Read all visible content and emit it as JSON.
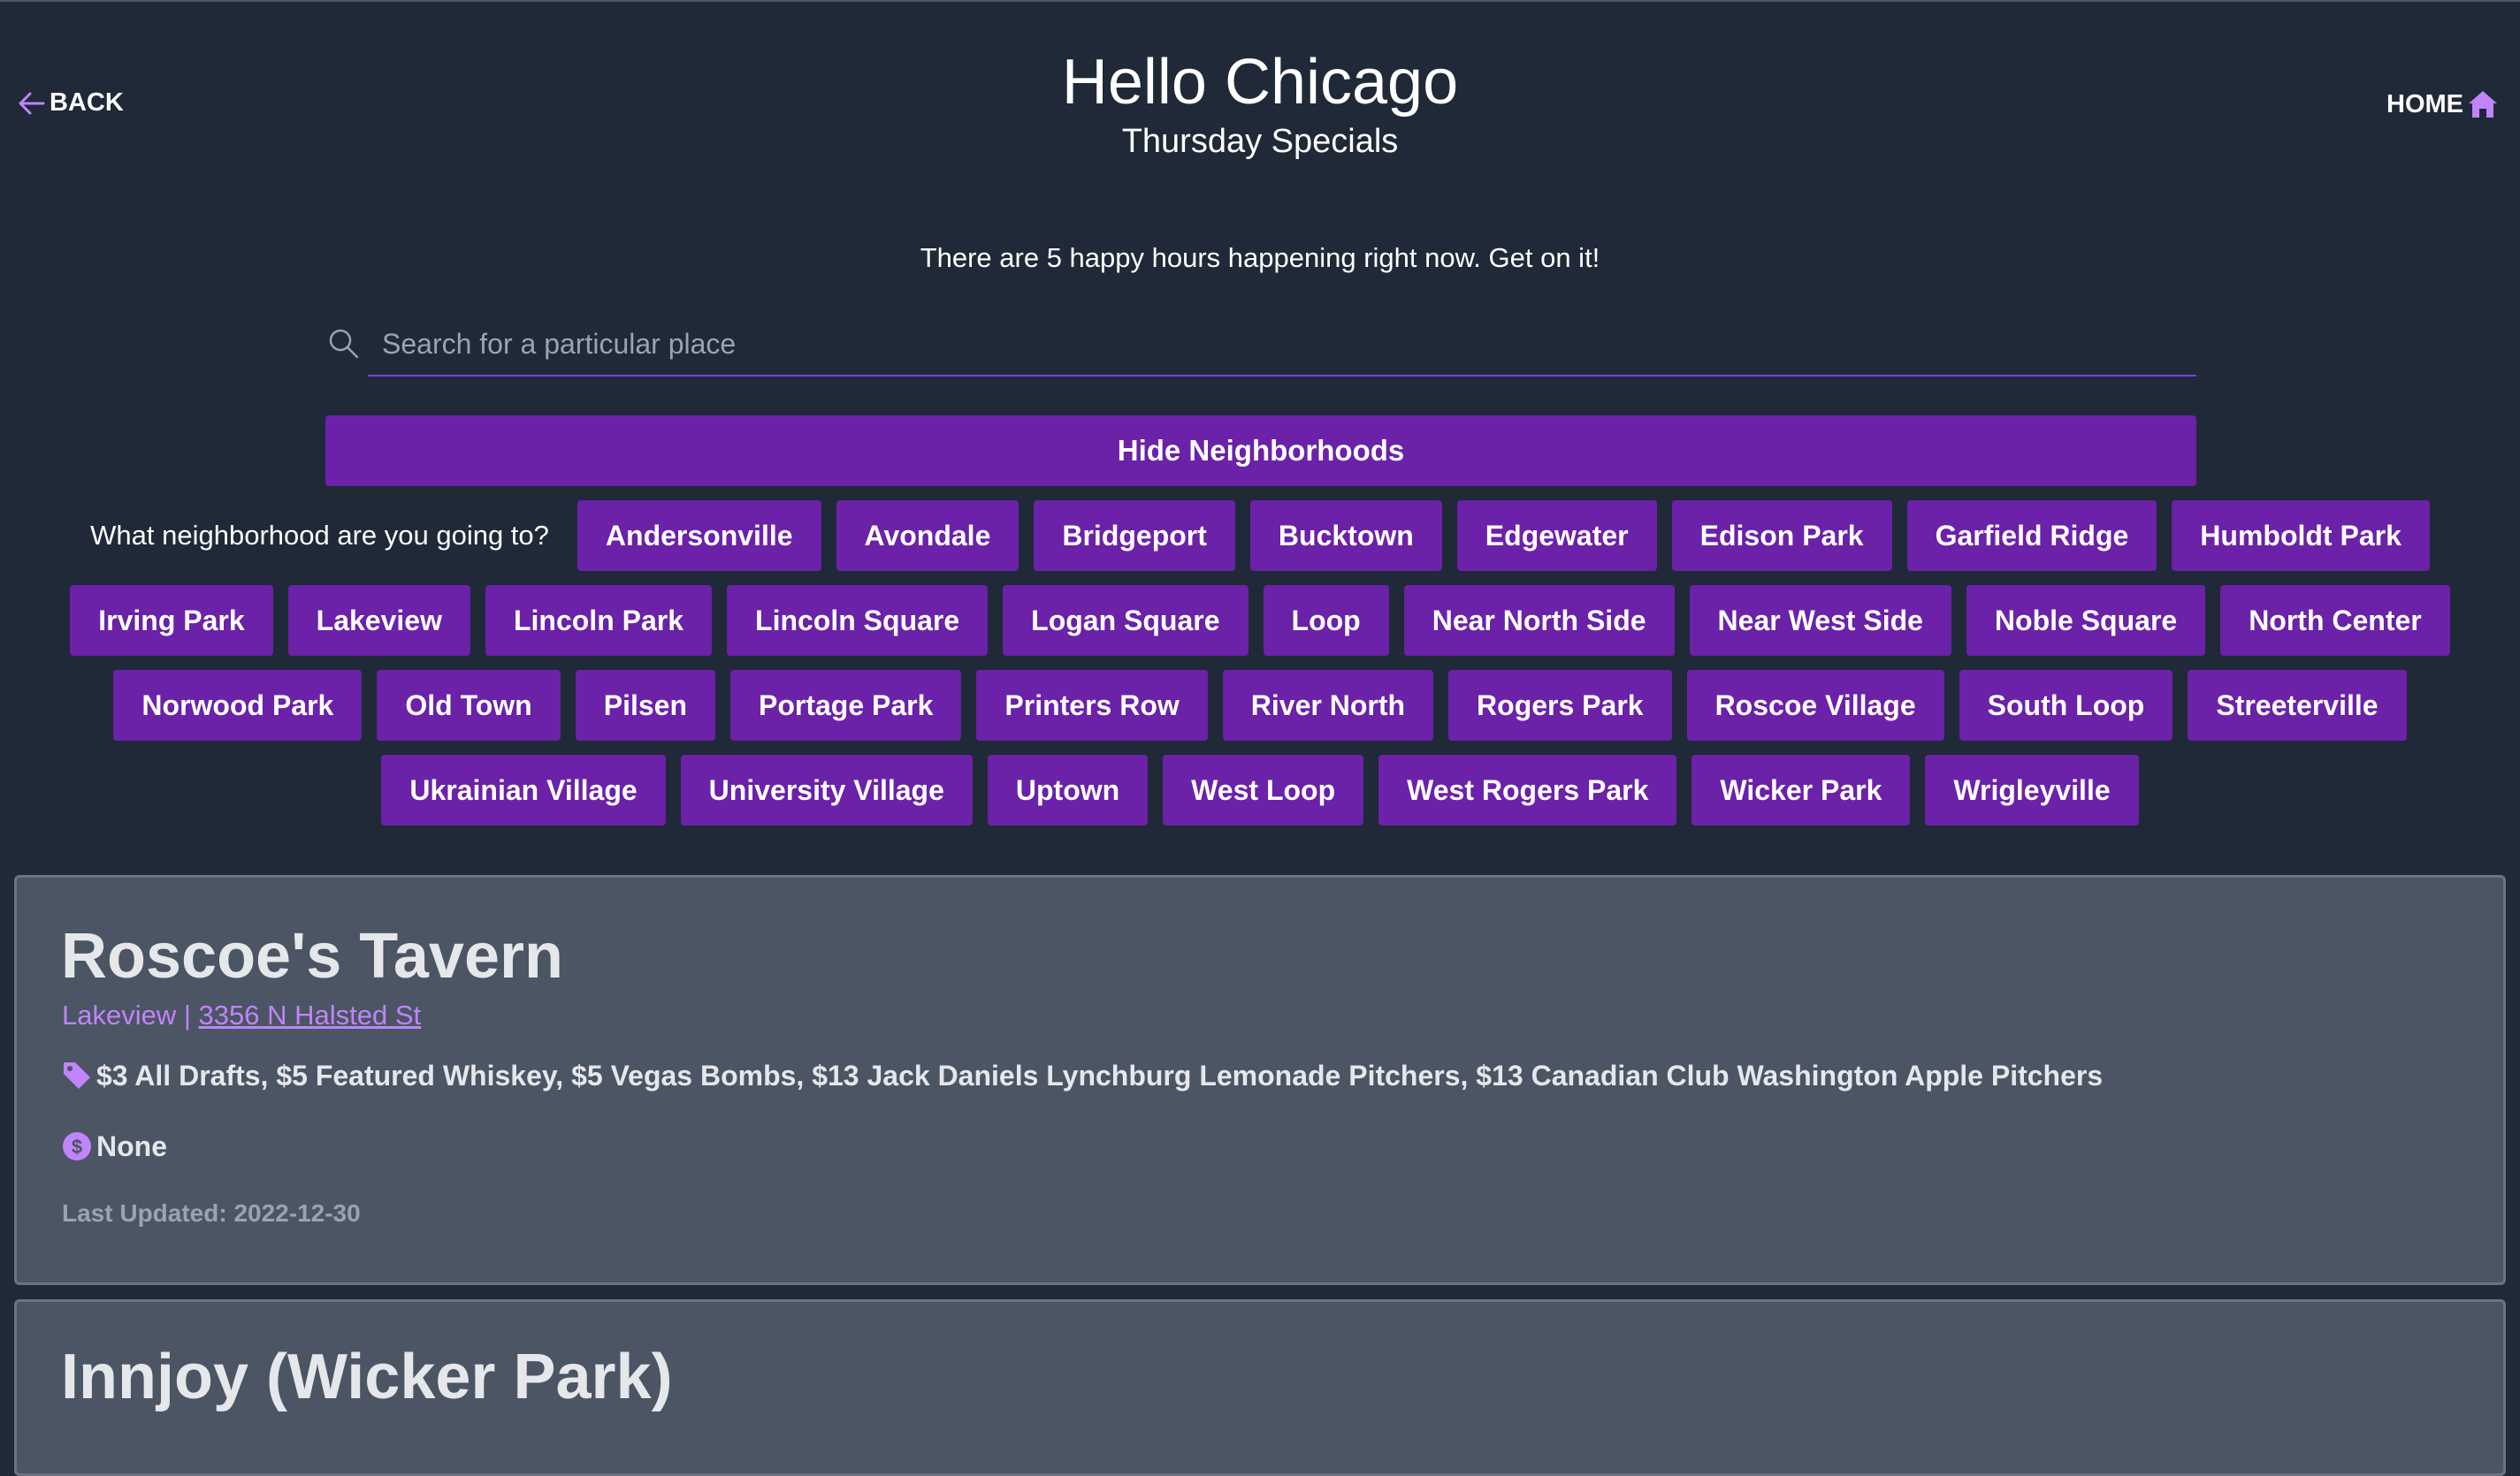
{
  "header": {
    "back_label": "BACK",
    "home_label": "HOME",
    "title": "Hello Chicago",
    "subtitle": "Thursday Specials"
  },
  "status_text": "There are 5 happy hours happening right now. Get on it!",
  "search": {
    "placeholder": "Search for a particular place",
    "value": ""
  },
  "hide_button_label": "Hide Neighborhoods",
  "neighborhood_question": "What neighborhood are you going to?",
  "neighborhoods": [
    "Andersonville",
    "Avondale",
    "Bridgeport",
    "Bucktown",
    "Edgewater",
    "Edison Park",
    "Garfield Ridge",
    "Humboldt Park",
    "Irving Park",
    "Lakeview",
    "Lincoln Park",
    "Lincoln Square",
    "Logan Square",
    "Loop",
    "Near North Side",
    "Near West Side",
    "Noble Square",
    "North Center",
    "Norwood Park",
    "Old Town",
    "Pilsen",
    "Portage Park",
    "Printers Row",
    "River North",
    "Rogers Park",
    "Roscoe Village",
    "South Loop",
    "Streeterville",
    "Ukrainian Village",
    "University Village",
    "Uptown",
    "West Loop",
    "West Rogers Park",
    "Wicker Park",
    "Wrigleyville"
  ],
  "cards": [
    {
      "name": "Roscoe's Tavern",
      "neighborhood": "Lakeview",
      "separator": " | ",
      "address": "3356 N Halsted St",
      "deals": "$3 All Drafts, $5 Featured Whiskey, $5 Vegas Bombs, $13 Jack Daniels Lynchburg Lemonade Pitchers, $13 Canadian Club Washington Apple Pitchers",
      "price": "None",
      "last_updated": "Last Updated: 2022-12-30"
    },
    {
      "name": "Innjoy (Wicker Park)"
    }
  ],
  "colors": {
    "background": "#1f2937",
    "accent": "#6b21a8",
    "accent_light": "#c084fc",
    "card_background": "#4b5563"
  },
  "icons": {
    "back": "arrow-left-icon",
    "home": "home-icon",
    "search": "search-icon",
    "deals": "tag-icon",
    "price": "dollar-icon"
  }
}
